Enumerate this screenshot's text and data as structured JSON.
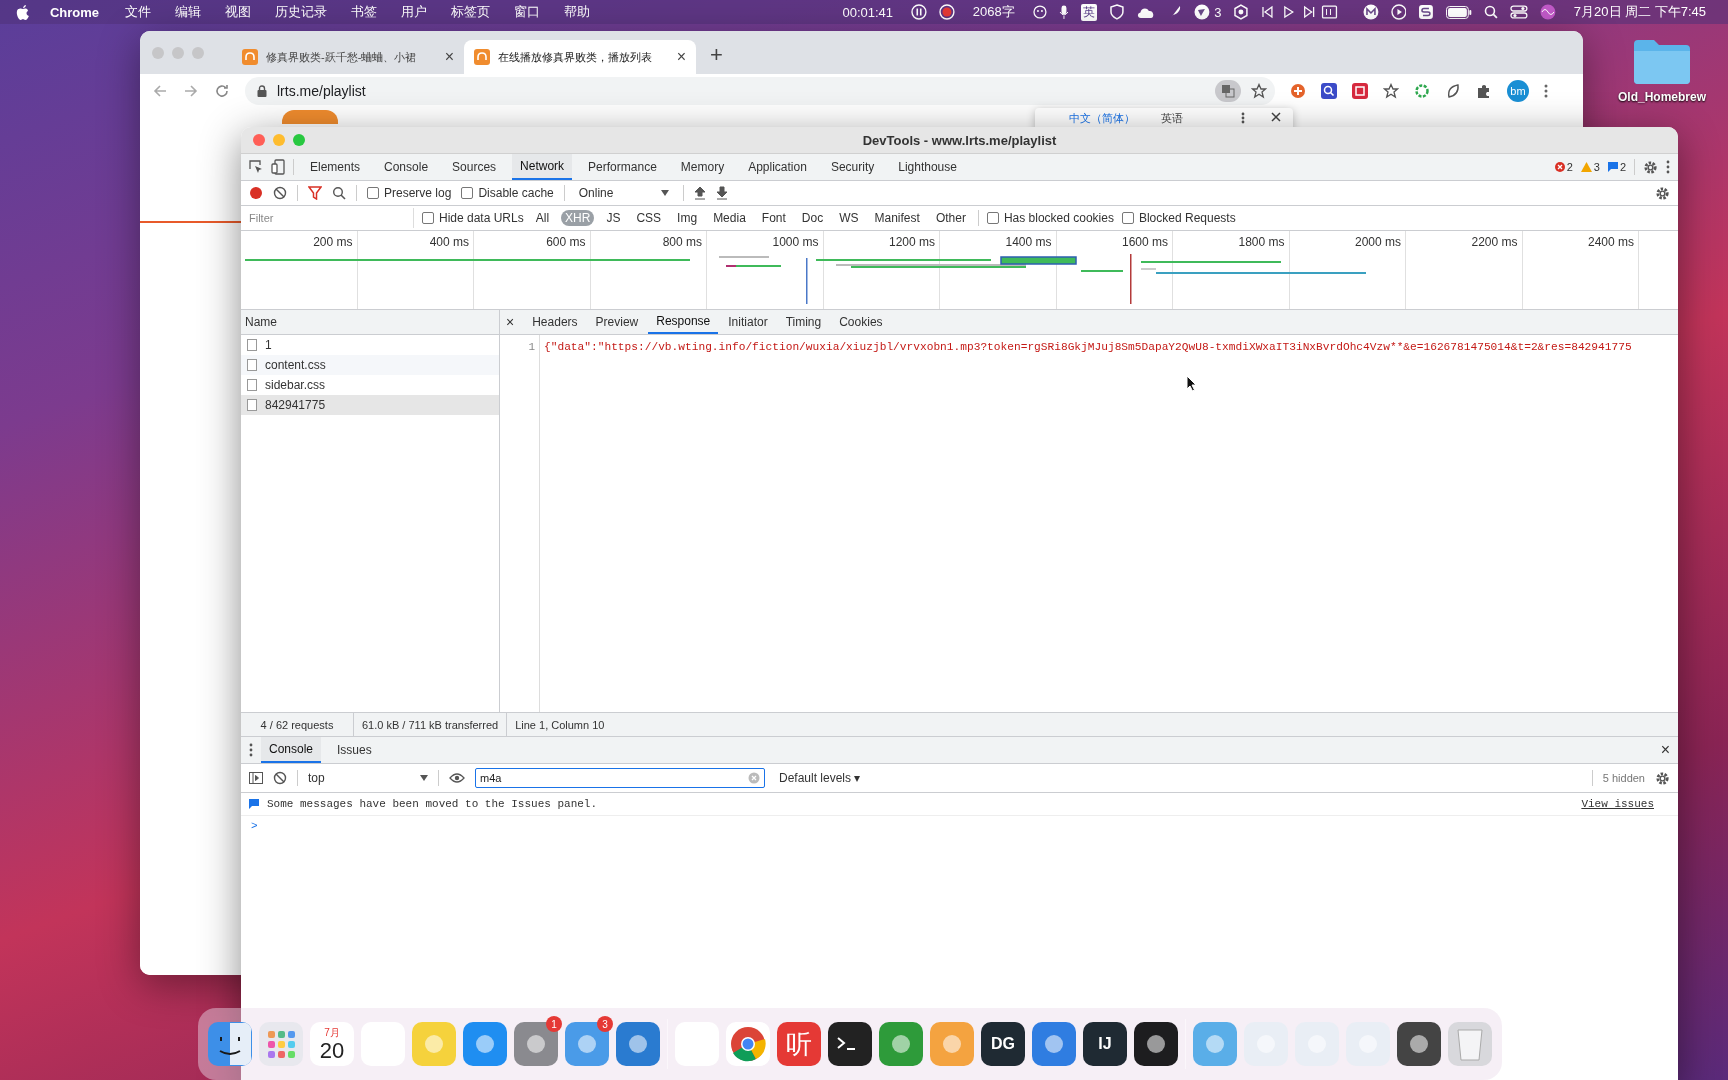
{
  "menu_bar": {
    "app": "Chrome",
    "menus": [
      "文件",
      "编辑",
      "视图",
      "历史记录",
      "书签",
      "用户",
      "标签页",
      "窗口",
      "帮助"
    ],
    "timer": "00:01:41",
    "word_count": "2068字",
    "input_method": "英",
    "notification_count": "3",
    "clock": "7月20日 周二 下午7:45"
  },
  "browser": {
    "tabs": [
      {
        "title": "修真界败类-跃千愁-蛐蛐、小裙",
        "selected": false,
        "close": "×"
      },
      {
        "title": "在线播放修真界败类，播放列表",
        "selected": true,
        "close": "×"
      }
    ],
    "new_tab": "+",
    "url": "lrts.me/playlist",
    "profile": "bm",
    "translate_popup": {
      "options": [
        {
          "label": "中文（简体）",
          "selected": true
        },
        {
          "label": "英语",
          "selected": false
        }
      ]
    }
  },
  "devtools": {
    "title": "DevTools - www.lrts.me/playlist",
    "panels": [
      {
        "label": "Elements",
        "selected": false
      },
      {
        "label": "Console",
        "selected": false
      },
      {
        "label": "Sources",
        "selected": false
      },
      {
        "label": "Network",
        "selected": true
      },
      {
        "label": "Performance",
        "selected": false
      },
      {
        "label": "Memory",
        "selected": false
      },
      {
        "label": "Application",
        "selected": false
      },
      {
        "label": "Security",
        "selected": false
      },
      {
        "label": "Lighthouse",
        "selected": false
      }
    ],
    "counts": [
      {
        "kind": "error",
        "text": "2"
      },
      {
        "kind": "warning",
        "text": "3"
      },
      {
        "kind": "info",
        "text": "2"
      }
    ],
    "recording": true,
    "options": [
      {
        "label": "Preserve log",
        "checked": false
      },
      {
        "label": "Disable cache",
        "checked": false
      }
    ],
    "throttling": "Online",
    "filter": {
      "placeholder": "Filter"
    },
    "hide_data_urls": {
      "label": "Hide data URLs",
      "checked": false
    },
    "types": [
      {
        "label": "All",
        "selected": false
      },
      {
        "label": "XHR",
        "selected": true
      },
      {
        "label": "JS",
        "selected": false
      },
      {
        "label": "CSS",
        "selected": false
      },
      {
        "label": "Img",
        "selected": false
      },
      {
        "label": "Media",
        "selected": false
      },
      {
        "label": "Font",
        "selected": false
      },
      {
        "label": "Doc",
        "selected": false
      },
      {
        "label": "WS",
        "selected": false
      },
      {
        "label": "Manifest",
        "selected": false
      },
      {
        "label": "Other",
        "selected": false
      }
    ],
    "blocked_filters": [
      {
        "label": "Has blocked cookies",
        "checked": false
      },
      {
        "label": "Blocked Requests",
        "checked": false
      }
    ],
    "timeline_ticks": [
      "200 ms",
      "400 ms",
      "600 ms",
      "800 ms",
      "1000 ms",
      "1200 ms",
      "1400 ms",
      "1600 ms",
      "1800 ms",
      "2000 ms",
      "2200 ms",
      "2400 ms"
    ],
    "requests": {
      "column": "Name",
      "rows": [
        {
          "name": "1",
          "selected": false
        },
        {
          "name": "content.css",
          "selected": false
        },
        {
          "name": "sidebar.css",
          "selected": false
        },
        {
          "name": "842941775",
          "selected": true
        }
      ]
    },
    "detail_close": "×",
    "detail_tabs": [
      {
        "label": "Headers",
        "selected": false
      },
      {
        "label": "Preview",
        "selected": false
      },
      {
        "label": "Response",
        "selected": true
      },
      {
        "label": "Initiator",
        "selected": false
      },
      {
        "label": "Timing",
        "selected": false
      },
      {
        "label": "Cookies",
        "selected": false
      }
    ],
    "response": {
      "line_number": "1",
      "text": "{\"data\":\"https://vb.wting.info/fiction/wuxia/xiuzjbl/vrvxobn1.mp3?token=rgSRi8GkjMJuj8Sm5DapaY2QwU8-txmdiXWxaIT3iNxBvrdOhc4Vzw**&e=1626781475014&t=2&res=842941775"
    },
    "status": {
      "requests": "4 / 62 requests",
      "transferred": "61.0 kB / 711 kB transferred",
      "cursor": "Line 1, Column 10"
    },
    "drawer": {
      "tabs": [
        {
          "label": "Console",
          "selected": true
        },
        {
          "label": "Issues",
          "selected": false
        }
      ],
      "close": "×",
      "context": "top",
      "filter_value": "m4a",
      "levels": "Default levels ▾",
      "hidden": "5 hidden",
      "message": "Some messages have been moved to the Issues panel.",
      "link": "View issues",
      "prompt": ">"
    }
  },
  "desktop_icon": {
    "label": "Old_Homebrew"
  },
  "dock": [
    {
      "kind": "finder"
    },
    {
      "kind": "launchpad"
    },
    {
      "kind": "calendar",
      "month": "7月",
      "day": "20"
    },
    {
      "kind": "reminders"
    },
    {
      "kind": "notes"
    },
    {
      "kind": "appstore"
    },
    {
      "kind": "settings",
      "badge": "1"
    },
    {
      "kind": "bird",
      "badge": "3"
    },
    {
      "kind": "vscode"
    },
    {
      "kind": "divider"
    },
    {
      "kind": "mail"
    },
    {
      "kind": "chrome"
    },
    {
      "kind": "listen",
      "text": "听"
    },
    {
      "kind": "terminal"
    },
    {
      "kind": "leaf"
    },
    {
      "kind": "pages"
    },
    {
      "kind": "letters",
      "text": "DG"
    },
    {
      "kind": "shield"
    },
    {
      "kind": "letters",
      "text": "IJ"
    },
    {
      "kind": "movie"
    },
    {
      "kind": "divider"
    },
    {
      "kind": "folder"
    },
    {
      "kind": "window"
    },
    {
      "kind": "window"
    },
    {
      "kind": "window"
    },
    {
      "kind": "sheet"
    },
    {
      "kind": "trash"
    }
  ]
}
